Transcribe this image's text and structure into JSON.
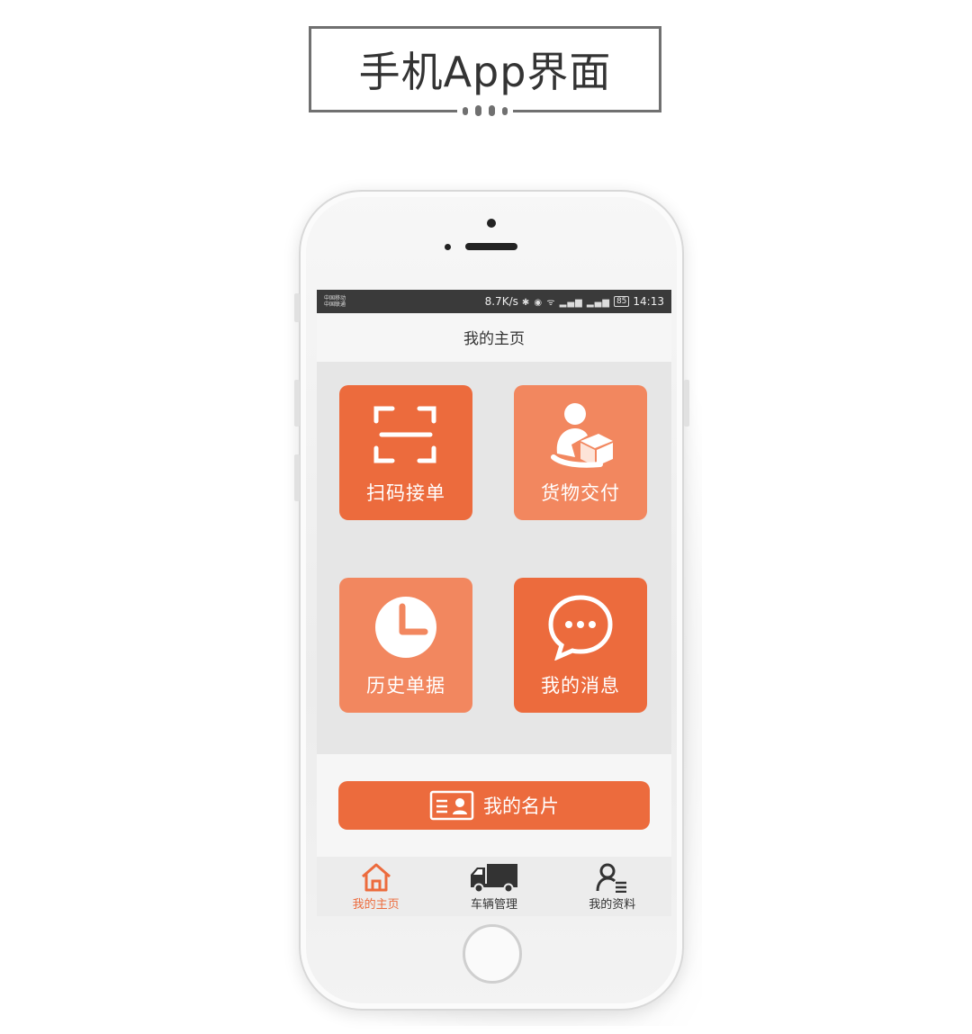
{
  "header": {
    "title": "手机App界面"
  },
  "status_bar": {
    "carrier_1": "中国移动",
    "carrier_2": "中国联通",
    "speed": "8.7K/s",
    "icons": "✱ ◉ ᯤ ▂▄▆ ▂▄▆",
    "battery": "85",
    "time": "14:13"
  },
  "screen": {
    "title": "我的主页",
    "tiles": [
      {
        "label": "扫码接单",
        "icon": "scan-icon",
        "color": "#ec6b3d"
      },
      {
        "label": "货物交付",
        "icon": "delivery-person-icon",
        "color": "#f2875f"
      },
      {
        "label": "历史单据",
        "icon": "clock-icon",
        "color": "#f2875f"
      },
      {
        "label": "我的消息",
        "icon": "chat-bubble-icon",
        "color": "#ec6b3d"
      }
    ],
    "card_button": {
      "label": "我的名片",
      "icon": "id-card-icon"
    },
    "tabs": [
      {
        "label": "我的主页",
        "icon": "home-icon",
        "active": true
      },
      {
        "label": "车辆管理",
        "icon": "truck-icon",
        "active": false
      },
      {
        "label": "我的资料",
        "icon": "profile-icon",
        "active": false
      }
    ]
  },
  "colors": {
    "accent": "#ec6b3d",
    "accent_light": "#f2875f",
    "tabbar": "#ececec"
  }
}
